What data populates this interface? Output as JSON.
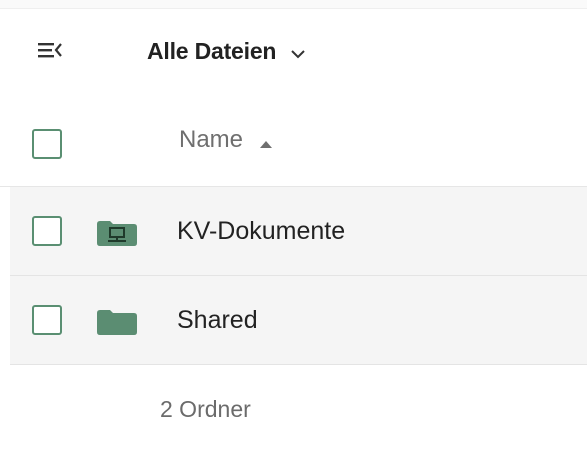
{
  "header": {
    "title": "Alle Dateien",
    "menu_icon": "menu-collapse-icon",
    "dropdown_icon": "chevron-down-icon"
  },
  "columns": {
    "name_label": "Name",
    "sort_icon": "sort-ascending-icon"
  },
  "files": [
    {
      "name": "KV-Dokumente",
      "icon": "network-folder-icon"
    },
    {
      "name": "Shared",
      "icon": "folder-icon"
    }
  ],
  "footer": {
    "summary": "2 Ordner"
  },
  "colors": {
    "accent": "#5a8f72",
    "row_background": "#f5f5f5",
    "folder": "#5b8d72"
  }
}
